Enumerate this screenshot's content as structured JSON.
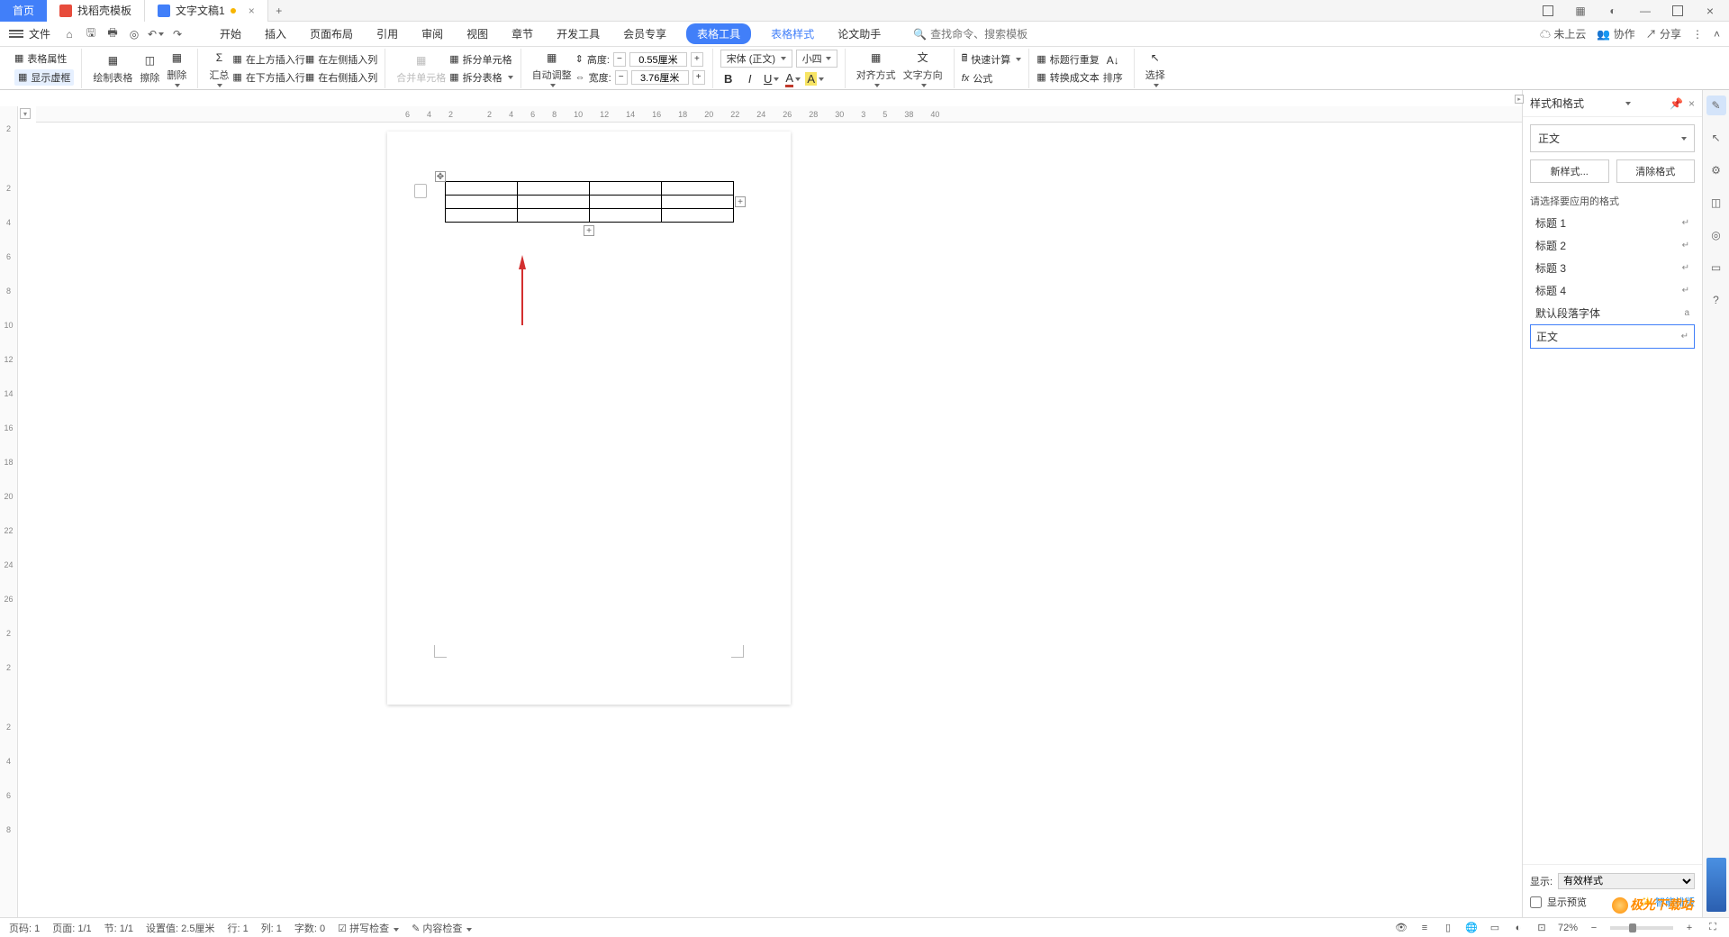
{
  "tabs": {
    "home": "首页",
    "template": "找稻壳模板",
    "doc": "文字文稿1"
  },
  "menu": {
    "file": "文件",
    "start": "开始",
    "insert": "插入",
    "page_layout": "页面布局",
    "reference": "引用",
    "review": "审阅",
    "view": "视图",
    "chapter": "章节",
    "dev_tools": "开发工具",
    "member": "会员专享",
    "table_tools": "表格工具",
    "table_style": "表格样式",
    "paper_helper": "论文助手",
    "search_ph": "查找命令、搜索模板",
    "not_cloud": "未上云",
    "coop": "协作",
    "share": "分享"
  },
  "ribbon": {
    "table_props": "表格属性",
    "show_frame": "显示虚框",
    "draw_table": "绘制表格",
    "erase": "擦除",
    "delete": "删除",
    "summary": "汇总",
    "insert_above": "在上方插入行",
    "insert_below": "在下方插入行",
    "insert_left": "在左侧插入列",
    "insert_right": "在右侧插入列",
    "merge_cells": "合并单元格",
    "split_cells": "拆分单元格",
    "split_table": "拆分表格",
    "auto_adjust": "自动调整",
    "height_label": "高度:",
    "height_value": "0.55厘米",
    "width_label": "宽度:",
    "width_value": "3.76厘米",
    "font_name": "宋体 (正文)",
    "font_size": "小四",
    "align": "对齐方式",
    "text_dir": "文字方向",
    "quick_calc": "快速计算",
    "formula": "公式",
    "repeat_header": "标题行重复",
    "to_text": "转换成文本",
    "sort": "排序",
    "select": "选择"
  },
  "ruler_h": [
    "6",
    "4",
    "2",
    "",
    "2",
    "4",
    "6",
    "8",
    "10",
    "12",
    "14",
    "16",
    "18",
    "20",
    "22",
    "24",
    "26",
    "28",
    "30",
    "3",
    "5",
    "38",
    "40"
  ],
  "ruler_v": [
    "2",
    "",
    "2",
    "4",
    "6",
    "8",
    "10",
    "12",
    "14",
    "16",
    "18",
    "20",
    "22",
    "24",
    "26",
    "2",
    "2",
    "",
    "2",
    "4",
    "6",
    "8"
  ],
  "panel": {
    "title": "样式和格式",
    "current": "正文",
    "new_style": "新样式...",
    "clear_format": "清除格式",
    "select_prompt": "请选择要应用的格式",
    "styles": [
      "标题 1",
      "标题 2",
      "标题 3",
      "标题 4",
      "默认段落字体",
      "正文"
    ],
    "show_label": "显示:",
    "show_value": "有效样式",
    "preview_cb": "显示预览",
    "smart_layout": "智能排版"
  },
  "status": {
    "page": "页码: 1",
    "pages": "页面: 1/1",
    "section": "节: 1/1",
    "pos": "设置值: 2.5厘米",
    "line": "行: 1",
    "col": "列: 1",
    "words": "字数: 0",
    "spell": "拼写检查",
    "content": "内容检查",
    "zoom": "72%"
  },
  "watermark": "极光下载站"
}
